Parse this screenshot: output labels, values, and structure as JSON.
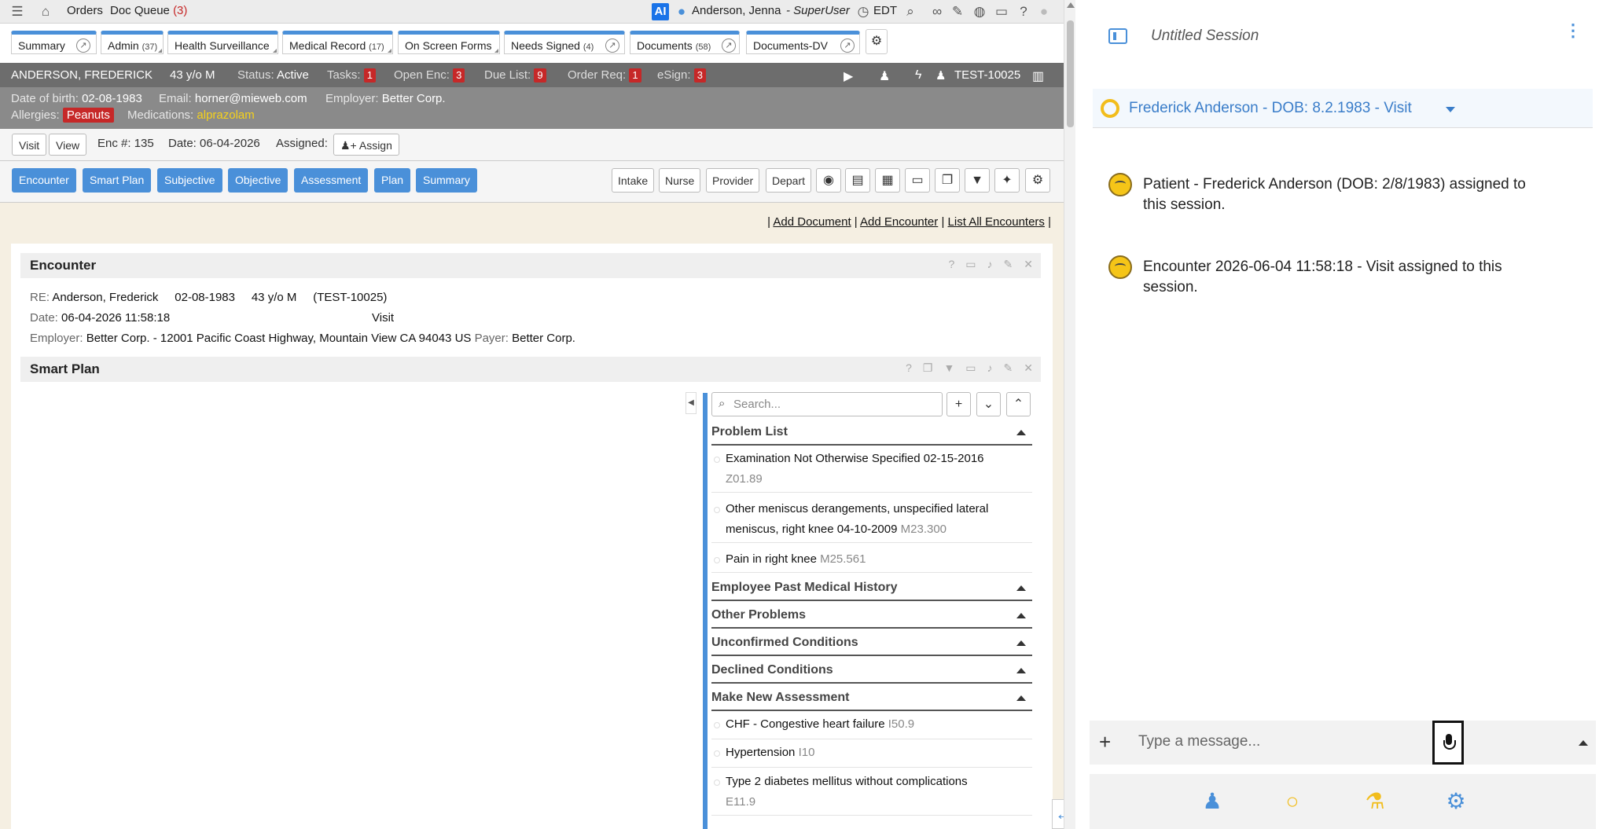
{
  "topbar": {
    "orders": "Orders",
    "doc_queue": "Doc Queue",
    "doc_queue_count": "(3)",
    "ai": "AI",
    "user": "Anderson, Jenna",
    "role": "- SuperUser",
    "timezone": "EDT"
  },
  "tabs": [
    {
      "label": "Summary",
      "count": ""
    },
    {
      "label": "Admin",
      "count": "(37)"
    },
    {
      "label": "Health Surveillance",
      "count": ""
    },
    {
      "label": "Medical Record",
      "count": "(17)"
    },
    {
      "label": "On Screen Forms",
      "count": ""
    },
    {
      "label": "Needs Signed",
      "count": "(4)"
    },
    {
      "label": "Documents",
      "count": "(58)"
    },
    {
      "label": "Documents-DV",
      "count": ""
    }
  ],
  "patient": {
    "name": "ANDERSON, FREDERICK",
    "age": "43 y/o M",
    "status_label": "Status:",
    "status": "Active",
    "tasks_label": "Tasks:",
    "tasks": "1",
    "open_enc_label": "Open Enc:",
    "open_enc": "3",
    "due_list_label": "Due List:",
    "due_list": "9",
    "order_req_label": "Order Req:",
    "order_req": "1",
    "esign_label": "eSign:",
    "esign": "3",
    "id": "TEST-10025",
    "dob_label": "Date of birth:",
    "dob": "02-08-1983",
    "email_label": "Email:",
    "email": "horner@mieweb.com",
    "employer_label": "Employer:",
    "employer": "Better Corp.",
    "allergies_label": "Allergies:",
    "allergy": "Peanuts",
    "meds_label": "Medications:",
    "med": "alprazolam"
  },
  "visit": {
    "visit": "Visit",
    "view": "View",
    "enc_label": "Enc #:",
    "enc": "135",
    "date_label": "Date:",
    "date": "06-04-2026",
    "assigned_label": "Assigned:",
    "assign": "Assign"
  },
  "sections": [
    "Encounter",
    "Smart Plan",
    "Subjective",
    "Objective",
    "Assessment",
    "Plan",
    "Summary"
  ],
  "roles": [
    "Intake",
    "Nurse",
    "Provider",
    "Depart"
  ],
  "links": {
    "add_document": "Add Document",
    "add_encounter": "Add Encounter",
    "list_all": "List All Encounters"
  },
  "encounter": {
    "title": "Encounter",
    "re_label": "RE:",
    "re_name": "Anderson, Frederick",
    "re_dob": "02-08-1983",
    "re_age": "43 y/o M",
    "re_id": "(TEST-10025)",
    "date_label": "Date:",
    "date": "06-04-2026 11:58:18",
    "type": "Visit",
    "employer_label": "Employer:",
    "employer": "Better Corp. - 12001 Pacific Coast Highway, Mountain View CA 94043 US",
    "payer_label": "Payer:",
    "payer": "Better Corp."
  },
  "smart_plan": {
    "title": "Smart Plan",
    "search_placeholder": "Search...",
    "groups": {
      "problem_list": "Problem List",
      "past_medical": "Employee Past Medical History",
      "other": "Other Problems",
      "unconfirmed": "Unconfirmed Conditions",
      "declined": "Declined Conditions",
      "new_assessment": "Make New Assessment"
    },
    "problems": [
      {
        "text": "Examination Not Otherwise Specified 02-15-2016",
        "code": "Z01.89"
      },
      {
        "text": "Other meniscus derangements, unspecified lateral meniscus, right knee 04-10-2009",
        "code": "M23.300"
      },
      {
        "text": "Pain in right knee",
        "code": "M25.561"
      }
    ],
    "assessments": [
      {
        "text": "CHF - Congestive heart failure",
        "code": "I50.9"
      },
      {
        "text": "Hypertension",
        "code": "I10"
      },
      {
        "text": "Type 2 diabetes mellitus without complications",
        "code": "E11.9"
      }
    ]
  },
  "ai_panel": {
    "session_title": "Untitled Session",
    "patient_selector": "Frederick Anderson - DOB: 8.2.1983 - Visit",
    "messages": [
      "Patient - Frederick Anderson (DOB: 2/8/1983) assigned to this session.",
      "Encounter 2026-06-04 11:58:18 - Visit assigned to this session."
    ],
    "input_placeholder": "Type a message..."
  },
  "colors": {
    "accent": "#4a90d9",
    "badge_red": "#c62828",
    "header_gray": "#6d6d6d"
  }
}
